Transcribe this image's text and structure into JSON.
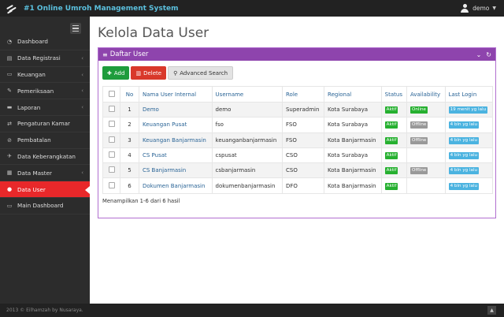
{
  "app": {
    "title": "#1 Online Umroh Management System",
    "user": "demo"
  },
  "sidebar": {
    "items": [
      {
        "label": "Dashboard",
        "icon": "dashboard-icon",
        "glyph": "◔",
        "chevron": false,
        "active": false
      },
      {
        "label": "Data Registrasi",
        "icon": "list-icon",
        "glyph": "▤",
        "chevron": true,
        "active": false
      },
      {
        "label": "Keuangan",
        "icon": "money-icon",
        "glyph": "▭",
        "chevron": true,
        "active": false
      },
      {
        "label": "Pemeriksaan",
        "icon": "edit-icon",
        "glyph": "✎",
        "chevron": true,
        "active": false
      },
      {
        "label": "Laporan",
        "icon": "folder-icon",
        "glyph": "▬",
        "chevron": true,
        "active": false
      },
      {
        "label": "Pengaturan Kamar",
        "icon": "exchange-icon",
        "glyph": "⇄",
        "chevron": false,
        "active": false
      },
      {
        "label": "Pembatalan",
        "icon": "cancel-icon",
        "glyph": "⊘",
        "chevron": false,
        "active": false
      },
      {
        "label": "Data Keberangkatan",
        "icon": "plane-icon",
        "glyph": "✈",
        "chevron": false,
        "active": false
      },
      {
        "label": "Data Master",
        "icon": "table-icon",
        "glyph": "▦",
        "chevron": true,
        "active": false
      },
      {
        "label": "Data User",
        "icon": "users-icon",
        "glyph": "●",
        "chevron": false,
        "active": true
      },
      {
        "label": "Main Dashboard",
        "icon": "home-icon",
        "glyph": "▭",
        "chevron": false,
        "active": false
      }
    ]
  },
  "main": {
    "page_title": "Kelola Data User",
    "panel_title": "Daftar User",
    "buttons": {
      "add": "Add",
      "delete": "Delete",
      "advanced": "Advanced Search"
    },
    "columns": [
      "No",
      "Nama User Internal",
      "Username",
      "Role",
      "Regional",
      "Status",
      "Availability",
      "Last Login"
    ],
    "rows": [
      {
        "no": "1",
        "name": "Demo",
        "username": "demo",
        "role": "Superadmin",
        "regional": "Kota Surabaya",
        "status": "Aktif",
        "availability": "Online",
        "availability_color": "#26b030",
        "last_login": "19 menit yg lalu"
      },
      {
        "no": "2",
        "name": "Keuangan Pusat",
        "username": "fso",
        "role": "FSO",
        "regional": "Kota Surabaya",
        "status": "Aktif",
        "availability": "Offline",
        "availability_color": "#999999",
        "last_login": "4 bln yg lalu"
      },
      {
        "no": "3",
        "name": "Keuangan Banjarmasin",
        "username": "keuanganbanjarmasin",
        "role": "FSO",
        "regional": "Kota Banjarmasin",
        "status": "Aktif",
        "availability": "Offline",
        "availability_color": "#999999",
        "last_login": "4 bln yg lalu"
      },
      {
        "no": "4",
        "name": "CS Pusat",
        "username": "cspusat",
        "role": "CSO",
        "regional": "Kota Surabaya",
        "status": "Aktif",
        "availability": "",
        "availability_color": "",
        "last_login": "4 bln yg lalu"
      },
      {
        "no": "5",
        "name": "CS Banjarmasin",
        "username": "csbanjarmasin",
        "role": "CSO",
        "regional": "Kota Banjarmasin",
        "status": "Aktif",
        "availability": "Offline",
        "availability_color": "#999999",
        "last_login": "4 bln yg lalu"
      },
      {
        "no": "6",
        "name": "Dokumen Banjarmasin",
        "username": "dokumenbanjarmasin",
        "role": "DFO",
        "regional": "Kota Banjarmasin",
        "status": "Aktif",
        "availability": "",
        "availability_color": "",
        "last_login": "4 bln yg lalu"
      }
    ],
    "summary": "Menampilkan 1-6 dari 6 hasil"
  },
  "footer": {
    "text": "2013 © Eilhamzah by Nusaraya."
  },
  "colors": {
    "panel_header": "#8e44ad",
    "active_nav": "#e8282a",
    "add_button": "#1e9c3c",
    "delete_button": "#d9382b",
    "brand_text": "#5bc0de"
  }
}
